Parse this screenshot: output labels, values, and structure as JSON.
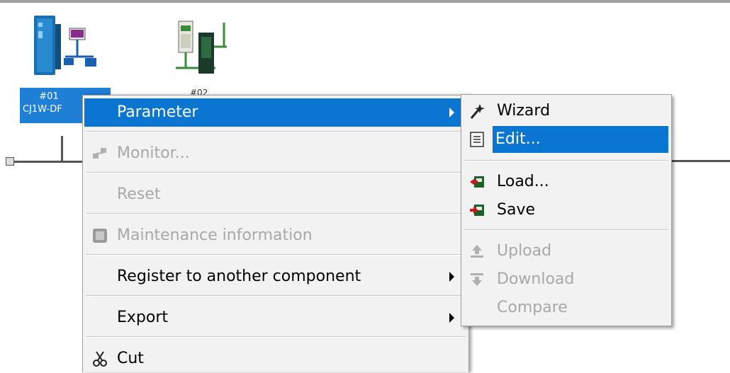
{
  "devices": [
    {
      "line1": "#01",
      "line2": "CJ1W-DF"
    },
    {
      "line1": "#02"
    }
  ],
  "main_menu": {
    "items": [
      {
        "label": "Parameter",
        "state": "highlighted",
        "submenu": true
      },
      {
        "label": "Monitor...",
        "state": "disabled",
        "icon": "monitor-icon"
      },
      {
        "label": "Reset",
        "state": "disabled"
      },
      {
        "label": "Maintenance information",
        "state": "disabled",
        "icon": "maintenance-icon"
      },
      {
        "label": "Register to another component",
        "state": "enabled",
        "submenu": true
      },
      {
        "label": "Export",
        "state": "enabled",
        "submenu": true
      },
      {
        "label": "Cut",
        "state": "enabled",
        "icon": "scissors-icon"
      }
    ]
  },
  "sub_menu": {
    "items": [
      {
        "label": "Wizard",
        "state": "enabled",
        "icon": "wizard-wand-icon"
      },
      {
        "label": "Edit...",
        "state": "highlighted",
        "icon": "edit-document-icon"
      },
      {
        "label": "Load...",
        "state": "enabled",
        "icon": "load-icon"
      },
      {
        "label": "Save",
        "state": "enabled",
        "icon": "save-icon"
      },
      {
        "label": "Upload",
        "state": "disabled",
        "icon": "upload-icon"
      },
      {
        "label": "Download",
        "state": "disabled",
        "icon": "download-icon"
      },
      {
        "label": "Compare",
        "state": "disabled"
      }
    ]
  },
  "colors": {
    "highlight": "#0a76d1",
    "disabled_text": "#a8a8a8",
    "menu_bg": "#f2f2f2"
  }
}
